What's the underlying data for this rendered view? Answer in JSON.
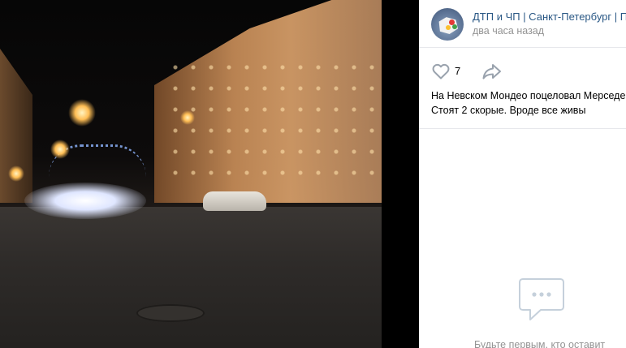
{
  "post": {
    "group_name": "ДТП и ЧП | Санкт-Петербург | Пи",
    "time": "два часа назад",
    "likes": "7",
    "text_line1": "На Невском Мондео поцеловал Мерседе",
    "text_line2": "Стоят 2 скорые. Вроде все живы"
  },
  "comments": {
    "empty_text": "Будьте первым, кто оставит"
  },
  "icons": {
    "like": "heart-icon",
    "share": "share-arrow-icon",
    "comments": "speech-bubble-icon"
  },
  "colors": {
    "link": "#2a5885",
    "muted": "#939393",
    "icon": "#99a2ad",
    "divider": "#e7e8ec"
  }
}
